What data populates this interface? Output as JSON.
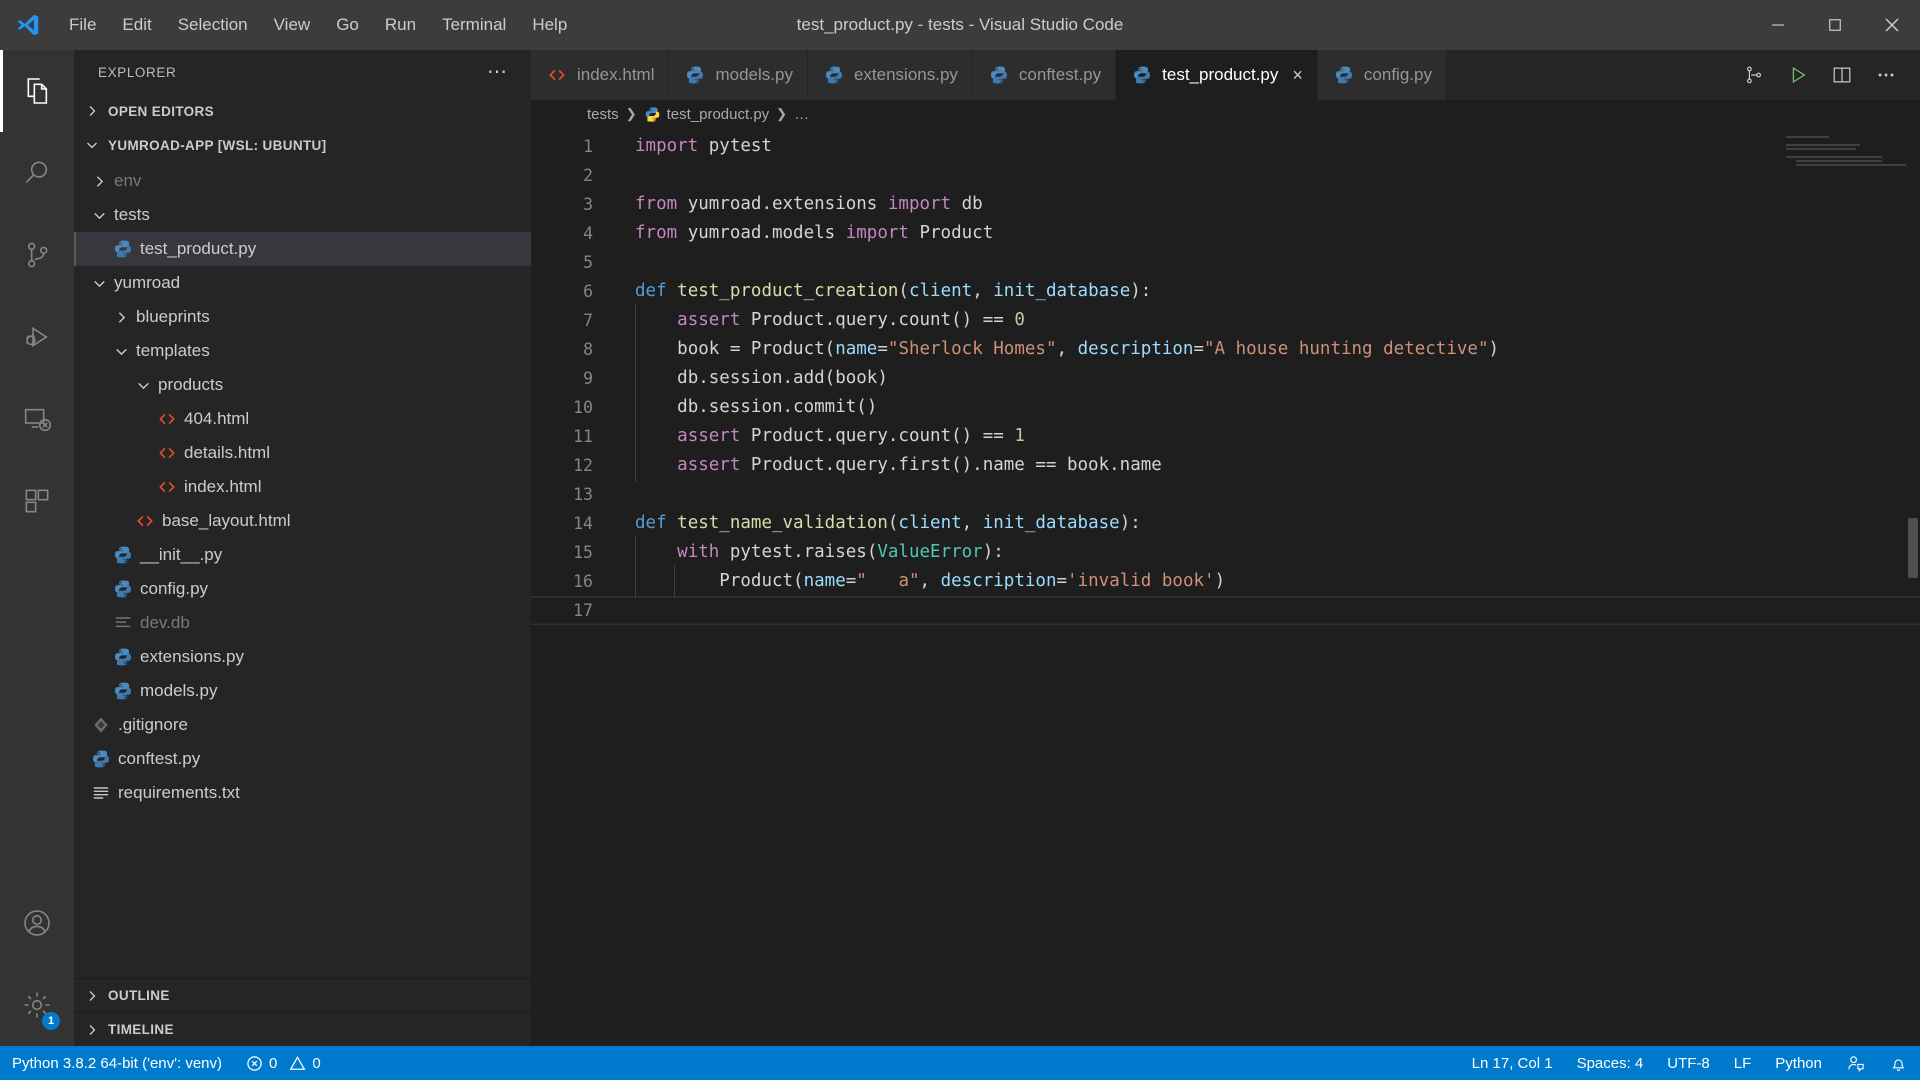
{
  "window": {
    "title": "test_product.py - tests - Visual Studio Code",
    "logo_icon": "vscode-logo-icon",
    "controls": [
      {
        "name": "minimize-button",
        "icon": "minimize-icon"
      },
      {
        "name": "maximize-button",
        "icon": "maximize-icon"
      },
      {
        "name": "close-button",
        "icon": "close-icon"
      }
    ]
  },
  "menubar": {
    "items": [
      "File",
      "Edit",
      "Selection",
      "View",
      "Go",
      "Run",
      "Terminal",
      "Help"
    ]
  },
  "activitybar": {
    "items": [
      {
        "name": "explorer",
        "icon": "files-icon",
        "active": true,
        "badge": ""
      },
      {
        "name": "search",
        "icon": "search-icon",
        "active": false,
        "badge": ""
      },
      {
        "name": "source-control",
        "icon": "source-control-icon",
        "active": false,
        "badge": ""
      },
      {
        "name": "run-and-debug",
        "icon": "debug-icon",
        "active": false,
        "badge": ""
      },
      {
        "name": "remote-explorer",
        "icon": "remote-icon",
        "active": false,
        "badge": ""
      },
      {
        "name": "extensions",
        "icon": "extensions-icon",
        "active": false,
        "badge": ""
      }
    ],
    "bottom": [
      {
        "name": "accounts",
        "icon": "account-icon",
        "badge": ""
      },
      {
        "name": "settings",
        "icon": "gear-icon",
        "badge": "1"
      }
    ]
  },
  "sidebar": {
    "title": "EXPLORER",
    "more_actions_icon": "ellipsis-icon",
    "open_editors": {
      "label": "OPEN EDITORS",
      "expanded": false
    },
    "workspace": {
      "label": "YUMROAD-APP [WSL: UBUNTU]",
      "expanded": true
    },
    "tree": [
      {
        "label": "env",
        "indent": 1,
        "type": "folder",
        "expanded": false,
        "icon": "chevron-right-icon",
        "dim": true,
        "selected": false
      },
      {
        "label": "tests",
        "indent": 1,
        "type": "folder",
        "expanded": true,
        "icon": "chevron-down-icon",
        "dim": false,
        "selected": false
      },
      {
        "label": "test_product.py",
        "indent": 2,
        "type": "python",
        "expanded": null,
        "icon": "python-file-icon",
        "dim": false,
        "selected": true
      },
      {
        "label": "yumroad",
        "indent": 1,
        "type": "folder",
        "expanded": true,
        "icon": "chevron-down-icon",
        "dim": false,
        "selected": false
      },
      {
        "label": "blueprints",
        "indent": 2,
        "type": "folder",
        "expanded": false,
        "icon": "chevron-right-icon",
        "dim": false,
        "selected": false
      },
      {
        "label": "templates",
        "indent": 2,
        "type": "folder",
        "expanded": true,
        "icon": "chevron-down-icon",
        "dim": false,
        "selected": false
      },
      {
        "label": "products",
        "indent": 3,
        "type": "folder",
        "expanded": true,
        "icon": "chevron-down-icon",
        "dim": false,
        "selected": false
      },
      {
        "label": "404.html",
        "indent": 4,
        "type": "html",
        "expanded": null,
        "icon": "html-file-icon",
        "dim": false,
        "selected": false
      },
      {
        "label": "details.html",
        "indent": 4,
        "type": "html",
        "expanded": null,
        "icon": "html-file-icon",
        "dim": false,
        "selected": false
      },
      {
        "label": "index.html",
        "indent": 4,
        "type": "html",
        "expanded": null,
        "icon": "html-file-icon",
        "dim": false,
        "selected": false
      },
      {
        "label": "base_layout.html",
        "indent": 3,
        "type": "html",
        "expanded": null,
        "icon": "html-file-icon",
        "dim": false,
        "selected": false
      },
      {
        "label": "__init__.py",
        "indent": 2,
        "type": "python",
        "expanded": null,
        "icon": "python-file-icon",
        "dim": false,
        "selected": false
      },
      {
        "label": "config.py",
        "indent": 2,
        "type": "python",
        "expanded": null,
        "icon": "python-file-icon",
        "dim": false,
        "selected": false
      },
      {
        "label": "dev.db",
        "indent": 2,
        "type": "db",
        "expanded": null,
        "icon": "database-file-icon",
        "dim": true,
        "selected": false
      },
      {
        "label": "extensions.py",
        "indent": 2,
        "type": "python",
        "expanded": null,
        "icon": "python-file-icon",
        "dim": false,
        "selected": false
      },
      {
        "label": "models.py",
        "indent": 2,
        "type": "python",
        "expanded": null,
        "icon": "python-file-icon",
        "dim": false,
        "selected": false
      },
      {
        "label": ".gitignore",
        "indent": 1,
        "type": "git",
        "expanded": null,
        "icon": "git-file-icon",
        "dim": false,
        "selected": false
      },
      {
        "label": "conftest.py",
        "indent": 1,
        "type": "python",
        "expanded": null,
        "icon": "python-file-icon",
        "dim": false,
        "selected": false
      },
      {
        "label": "requirements.txt",
        "indent": 1,
        "type": "txt",
        "expanded": null,
        "icon": "text-file-icon",
        "dim": false,
        "selected": false
      }
    ],
    "panels": [
      {
        "label": "OUTLINE",
        "expanded": false
      },
      {
        "label": "TIMELINE",
        "expanded": false
      }
    ]
  },
  "editor": {
    "tabs": [
      {
        "label": "index.html",
        "icon": "html-file-icon",
        "active": false,
        "close": ""
      },
      {
        "label": "models.py",
        "icon": "python-file-icon",
        "active": false,
        "close": ""
      },
      {
        "label": "extensions.py",
        "icon": "python-file-icon",
        "active": false,
        "close": ""
      },
      {
        "label": "conftest.py",
        "icon": "python-file-icon",
        "active": false,
        "close": ""
      },
      {
        "label": "test_product.py",
        "icon": "python-file-icon",
        "active": true,
        "close": "×"
      },
      {
        "label": "config.py",
        "icon": "python-file-icon",
        "active": false,
        "close": ""
      }
    ],
    "tab_actions": [
      {
        "name": "source-control-action",
        "icon": "branch-icon"
      },
      {
        "name": "run-python-file",
        "icon": "play-icon"
      },
      {
        "name": "split-editor",
        "icon": "split-editor-icon"
      },
      {
        "name": "more-actions",
        "icon": "ellipsis-icon"
      }
    ],
    "breadcrumbs": [
      {
        "label": "tests",
        "icon": ""
      },
      {
        "label": "test_product.py",
        "icon": "python-file-icon"
      },
      {
        "label": "…",
        "icon": ""
      }
    ],
    "lines": [
      {
        "n": 1,
        "indent": 0,
        "tokens": [
          {
            "t": "import",
            "c": "k"
          },
          {
            "t": " pytest",
            "c": "pl"
          }
        ]
      },
      {
        "n": 2,
        "indent": 0,
        "tokens": []
      },
      {
        "n": 3,
        "indent": 0,
        "tokens": [
          {
            "t": "from",
            "c": "k"
          },
          {
            "t": " yumroad.extensions ",
            "c": "pl"
          },
          {
            "t": "import",
            "c": "k"
          },
          {
            "t": " db",
            "c": "pl"
          }
        ]
      },
      {
        "n": 4,
        "indent": 0,
        "tokens": [
          {
            "t": "from",
            "c": "k"
          },
          {
            "t": " yumroad.models ",
            "c": "pl"
          },
          {
            "t": "import",
            "c": "k"
          },
          {
            "t": " Product",
            "c": "pl"
          }
        ]
      },
      {
        "n": 5,
        "indent": 0,
        "tokens": []
      },
      {
        "n": 6,
        "indent": 0,
        "tokens": [
          {
            "t": "def",
            "c": "kb"
          },
          {
            "t": " ",
            "c": "pl"
          },
          {
            "t": "test_product_creation",
            "c": "fn"
          },
          {
            "t": "(",
            "c": "pl"
          },
          {
            "t": "client",
            "c": "pa"
          },
          {
            "t": ", ",
            "c": "pl"
          },
          {
            "t": "init_database",
            "c": "pa"
          },
          {
            "t": "):",
            "c": "pl"
          }
        ]
      },
      {
        "n": 7,
        "indent": 1,
        "tokens": [
          {
            "t": "assert",
            "c": "k"
          },
          {
            "t": " Product.query.count() == ",
            "c": "pl"
          },
          {
            "t": "0",
            "c": "nu"
          }
        ]
      },
      {
        "n": 8,
        "indent": 1,
        "tokens": [
          {
            "t": "book = Product(",
            "c": "pl"
          },
          {
            "t": "name",
            "c": "pa"
          },
          {
            "t": "=",
            "c": "pl"
          },
          {
            "t": "\"Sherlock Homes\"",
            "c": "st"
          },
          {
            "t": ", ",
            "c": "pl"
          },
          {
            "t": "description",
            "c": "pa"
          },
          {
            "t": "=",
            "c": "pl"
          },
          {
            "t": "\"A house hunting detective\"",
            "c": "st"
          },
          {
            "t": ")",
            "c": "pl"
          }
        ]
      },
      {
        "n": 9,
        "indent": 1,
        "tokens": [
          {
            "t": "db.session.add(book)",
            "c": "pl"
          }
        ]
      },
      {
        "n": 10,
        "indent": 1,
        "tokens": [
          {
            "t": "db.session.commit()",
            "c": "pl"
          }
        ]
      },
      {
        "n": 11,
        "indent": 1,
        "tokens": [
          {
            "t": "assert",
            "c": "k"
          },
          {
            "t": " Product.query.count() == ",
            "c": "pl"
          },
          {
            "t": "1",
            "c": "nu"
          }
        ]
      },
      {
        "n": 12,
        "indent": 1,
        "tokens": [
          {
            "t": "assert",
            "c": "k"
          },
          {
            "t": " Product.query.first().name == book.name",
            "c": "pl"
          }
        ]
      },
      {
        "n": 13,
        "indent": 0,
        "tokens": []
      },
      {
        "n": 14,
        "indent": 0,
        "tokens": [
          {
            "t": "def",
            "c": "kb"
          },
          {
            "t": " ",
            "c": "pl"
          },
          {
            "t": "test_name_validation",
            "c": "fn"
          },
          {
            "t": "(",
            "c": "pl"
          },
          {
            "t": "client",
            "c": "pa"
          },
          {
            "t": ", ",
            "c": "pl"
          },
          {
            "t": "init_database",
            "c": "pa"
          },
          {
            "t": "):",
            "c": "pl"
          }
        ]
      },
      {
        "n": 15,
        "indent": 1,
        "tokens": [
          {
            "t": "with",
            "c": "k"
          },
          {
            "t": " pytest.raises(",
            "c": "pl"
          },
          {
            "t": "ValueError",
            "c": "cl"
          },
          {
            "t": "):",
            "c": "pl"
          }
        ]
      },
      {
        "n": 16,
        "indent": 2,
        "tokens": [
          {
            "t": "Product(",
            "c": "pl"
          },
          {
            "t": "name",
            "c": "pa"
          },
          {
            "t": "=",
            "c": "pl"
          },
          {
            "t": "\"   a\"",
            "c": "st"
          },
          {
            "t": ", ",
            "c": "pl"
          },
          {
            "t": "description",
            "c": "pa"
          },
          {
            "t": "=",
            "c": "pl"
          },
          {
            "t": "'invalid book'",
            "c": "st"
          },
          {
            "t": ")",
            "c": "pl"
          }
        ]
      },
      {
        "n": 17,
        "indent": 0,
        "tokens": []
      }
    ]
  },
  "statusbar": {
    "left": [
      {
        "name": "python-interpreter",
        "label": "Python 3.8.2 64-bit ('env': venv)",
        "icon": ""
      },
      {
        "name": "problems",
        "label": "0",
        "icon": "error-icon",
        "label2": "0",
        "icon2": "warning-icon"
      }
    ],
    "right": [
      {
        "name": "cursor-position",
        "label": "Ln 17, Col 1"
      },
      {
        "name": "indentation",
        "label": "Spaces: 4"
      },
      {
        "name": "encoding",
        "label": "UTF-8"
      },
      {
        "name": "eol",
        "label": "LF"
      },
      {
        "name": "language-mode",
        "label": "Python"
      },
      {
        "name": "live-share",
        "label": "",
        "icon": "live-share-icon"
      },
      {
        "name": "notifications",
        "label": "",
        "icon": "bell-icon"
      }
    ]
  },
  "colors": {
    "accent": "#007acc",
    "titlebar_bg": "#3c3c3c",
    "sidebar_bg": "#252526",
    "editor_bg": "#1e1e1e",
    "activitybar_bg": "#333333",
    "selection_bg": "#37373d",
    "keyword": "#c586c0",
    "keyword_blue": "#569cd6",
    "function": "#dcdcaa",
    "param": "#9cdcfe",
    "string": "#ce9178",
    "number": "#b5cea8",
    "class": "#4ec9b0",
    "plain": "#d4d4d4",
    "python_icon": "#4b8bbe",
    "html_icon": "#e44d26"
  }
}
